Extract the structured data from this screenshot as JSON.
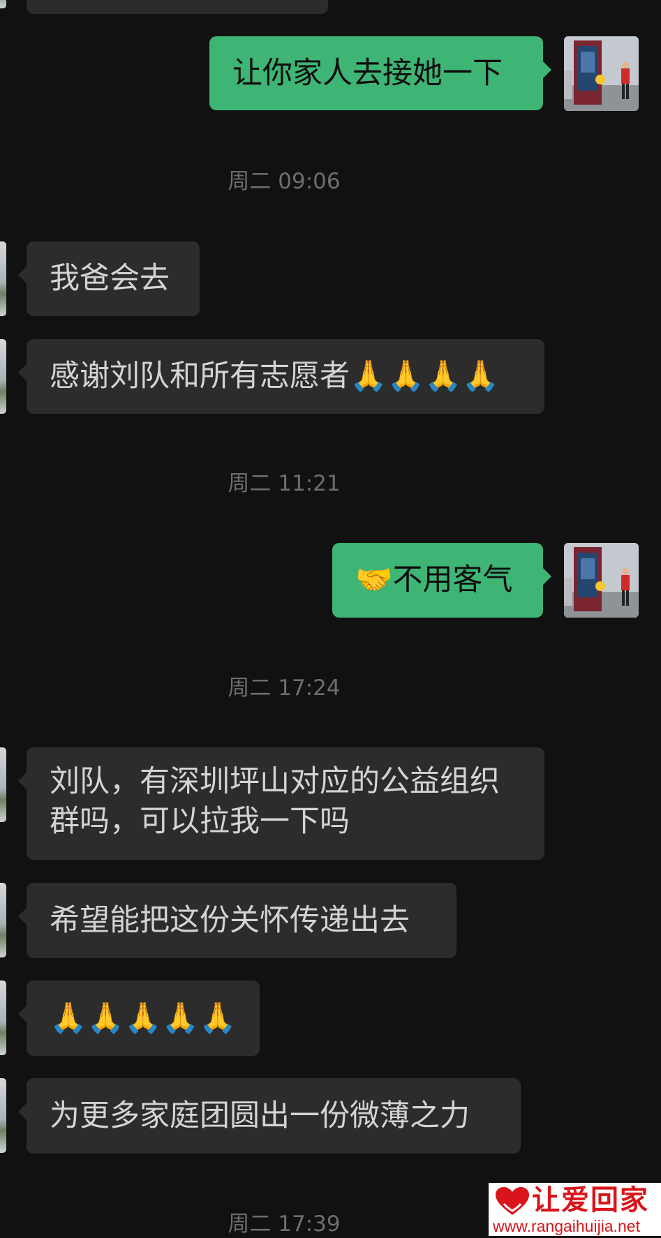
{
  "chat": {
    "messages": [
      {
        "side": "out",
        "text": "让你家人去接她一下"
      },
      {
        "type": "timestamp",
        "text": "周二 09:06"
      },
      {
        "side": "in",
        "text": "我爸会去"
      },
      {
        "side": "in",
        "text": "感谢刘队和所有志愿者",
        "emoji": "🙏🙏🙏🙏"
      },
      {
        "type": "timestamp",
        "text": "周二 11:21"
      },
      {
        "side": "out",
        "emoji": "🤝",
        "text": "不用客气"
      },
      {
        "type": "timestamp",
        "text": "周二 17:24"
      },
      {
        "side": "in",
        "line1": "刘队，有深圳坪山对应的公益组织",
        "line2": "群吗，可以拉我一下吗"
      },
      {
        "side": "in",
        "text": "希望能把这份关怀传递出去"
      },
      {
        "side": "in",
        "emoji": "🙏🙏🙏🙏🙏"
      },
      {
        "side": "in",
        "text": "为更多家庭团圆出一份微薄之力"
      },
      {
        "type": "timestamp",
        "text": "周二 17:39"
      }
    ]
  },
  "watermark": {
    "title": "让爱回家",
    "url": "www.rangaihuijia.net",
    "logo": "heart-hands-logo"
  },
  "icons": {
    "sent_avatar": "avatar-icon",
    "received_avatar": "avatar-icon"
  },
  "colors": {
    "background": "#111111",
    "incoming_bubble": "#2c2c2c",
    "outgoing_bubble": "#3eb575",
    "timestamp": "#6d6d6d",
    "watermark_red": "#d9151b"
  }
}
